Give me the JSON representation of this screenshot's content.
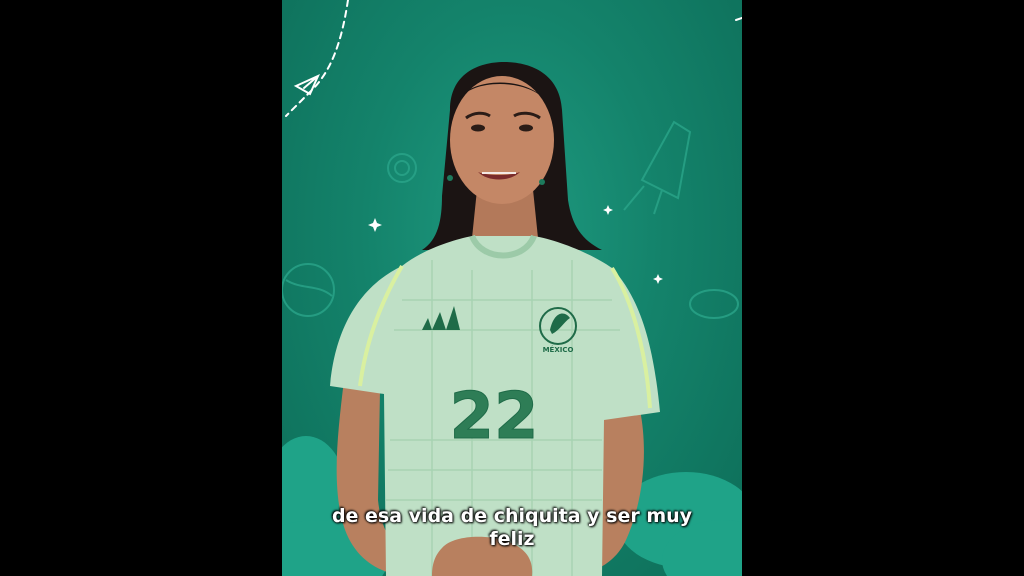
{
  "video": {
    "background_color": "#14836b",
    "letterbox_color": "#000000",
    "jersey_number": "22",
    "crest_text": "MÉXICO"
  },
  "subtitle": {
    "line1": "de esa vida de chiquita y ser muy",
    "line2": "feliz"
  }
}
